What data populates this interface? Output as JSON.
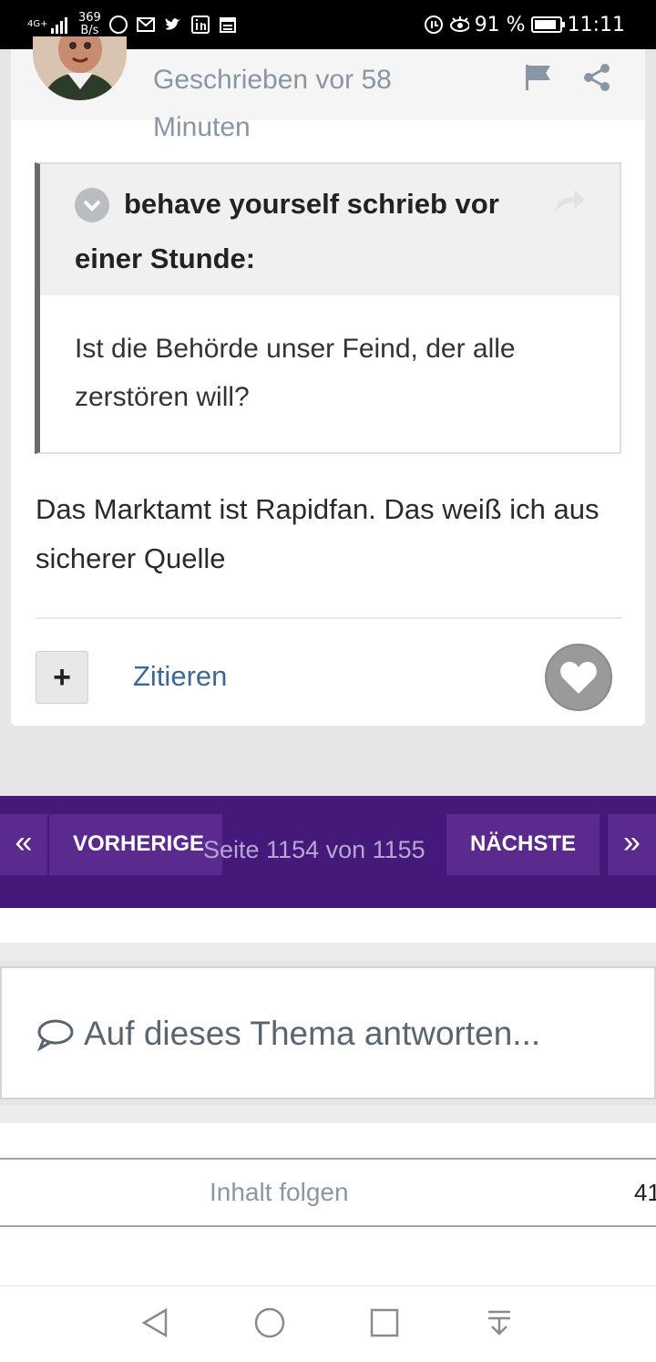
{
  "status_bar": {
    "network": "4G+",
    "speed_value": "369",
    "speed_unit": "B/s",
    "battery_percent": "91 %",
    "battery_level": 0.91,
    "time": "11:11"
  },
  "post": {
    "meta": "Geschrieben vor 58 Minuten",
    "quote": {
      "author_line": "behave yourself schrieb vor einer Stunde:",
      "text": "Ist die Behörde unser Feind, der alle zerstören will?"
    },
    "body": "Das Marktamt ist Rapidfan. Das weiß ich aus sicherer Quelle",
    "multiquote_label": "+",
    "quote_label": "Zitieren"
  },
  "pagination": {
    "first": "«",
    "prev": "VORHERIGE",
    "current": "Seite 1154 von 1155",
    "next": "NÄCHSTE",
    "last": "»"
  },
  "reply": {
    "placeholder": "Auf dieses Thema antworten..."
  },
  "follow": {
    "label": "Inhalt folgen",
    "count": "41"
  }
}
